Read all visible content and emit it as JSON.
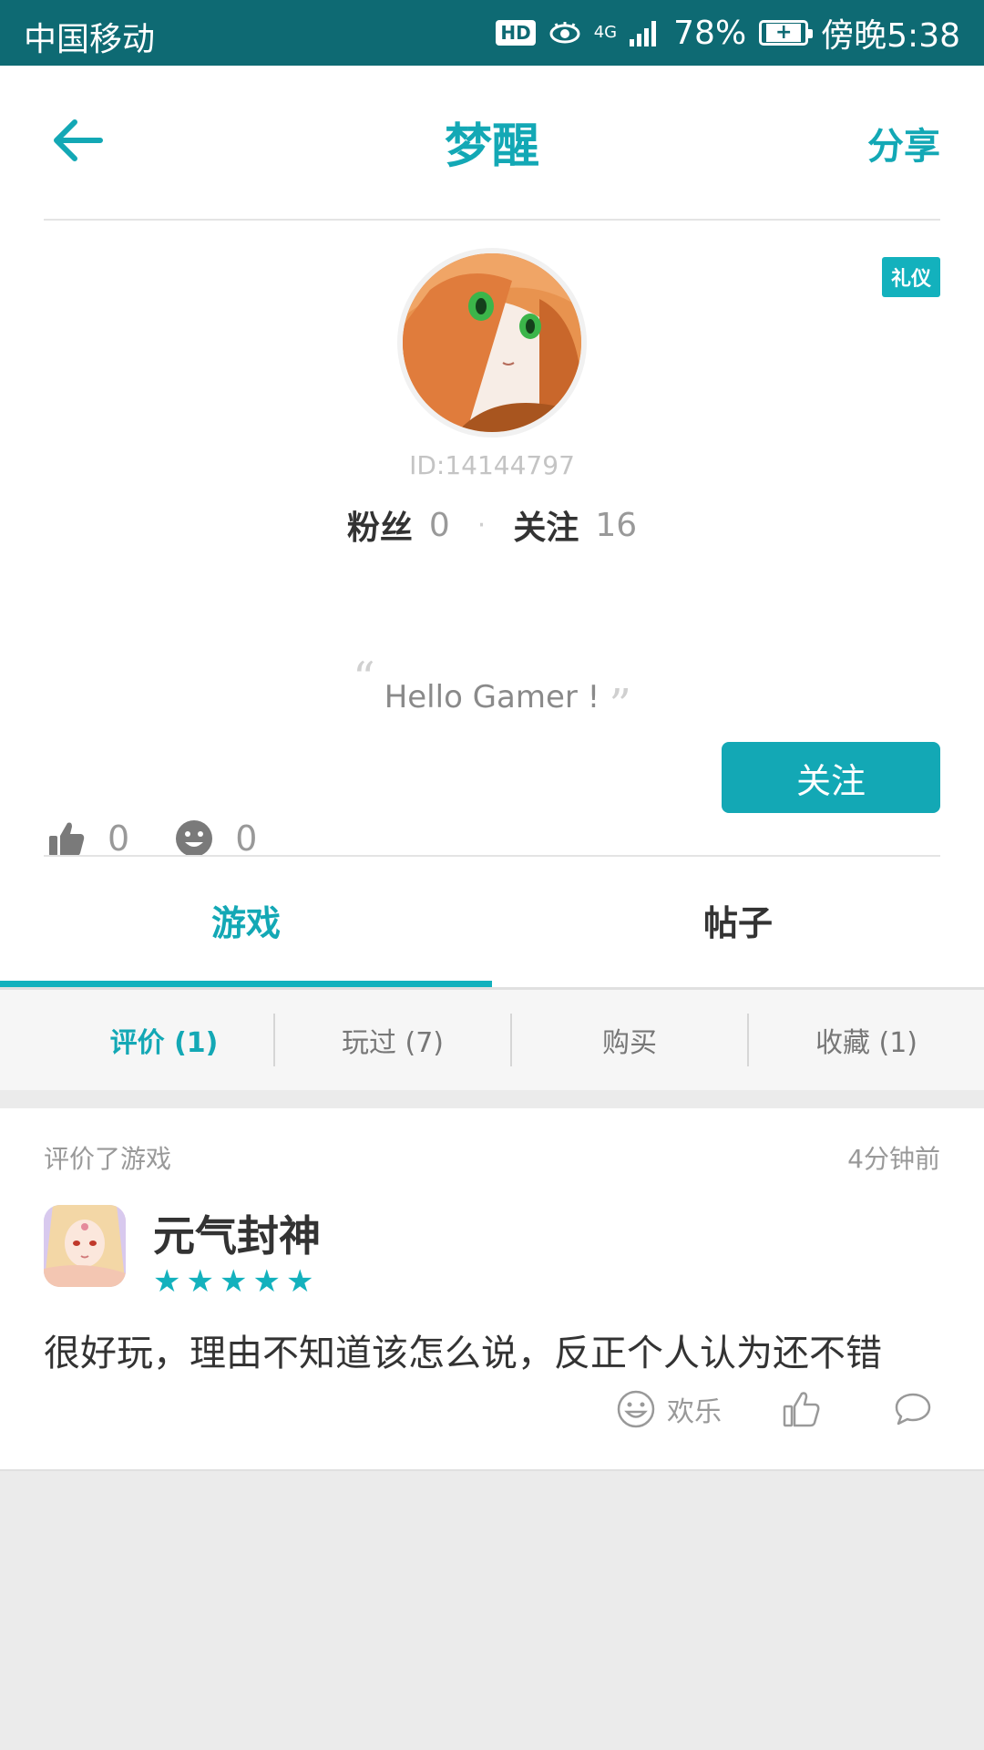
{
  "status_bar": {
    "carrier": "中国移动",
    "hd": "HD",
    "network": "4G",
    "battery_percent": "78%",
    "time": "傍晚5:38"
  },
  "header": {
    "title": "梦醒",
    "share_label": "分享"
  },
  "profile": {
    "badge": "礼仪",
    "user_id": "ID:14144797",
    "fans_label": "粉丝",
    "fans_count": "0",
    "following_label": "关注",
    "following_count": "16",
    "quote": "Hello Gamer !",
    "likes_count": "0",
    "fun_count": "0",
    "follow_button": "关注"
  },
  "tabs": [
    {
      "label": "游戏",
      "active": true
    },
    {
      "label": "帖子",
      "active": false
    }
  ],
  "subtabs": [
    {
      "label": "评价 (1)",
      "active": true
    },
    {
      "label": "玩过 (7)",
      "active": false
    },
    {
      "label": "购买",
      "active": false
    },
    {
      "label": "收藏 (1)",
      "active": false
    }
  ],
  "review": {
    "meta": "评价了游戏",
    "time": "4分钟前",
    "game_name": "元气封神",
    "rating": 5,
    "text": "很好玩，理由不知道该怎么说，反正个人认为还不错",
    "reaction_label": "欢乐"
  },
  "colors": {
    "accent": "#13a8b5",
    "status_bar": "#0e6a73"
  }
}
